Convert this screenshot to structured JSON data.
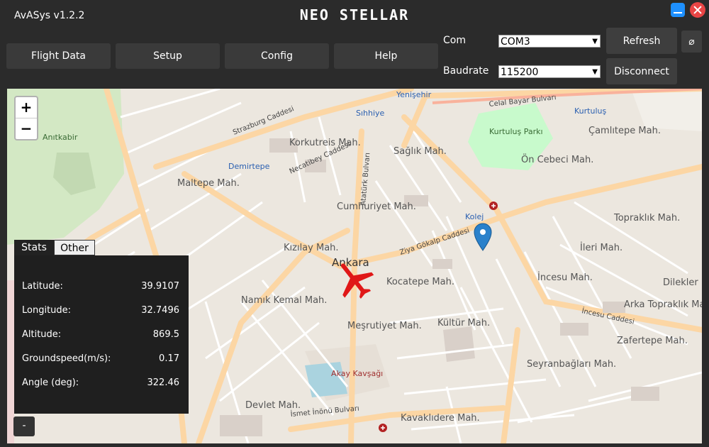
{
  "window": {
    "app_title": "AvASys v1.2.2",
    "brand": "NEO STELLAR"
  },
  "nav": {
    "flight_data": "Flight Data",
    "setup": "Setup",
    "config": "Config",
    "help": "Help"
  },
  "connection": {
    "com_label": "Com",
    "com_value": "COM3",
    "baud_label": "Baudrate",
    "baud_value": "115200",
    "refresh": "Refresh",
    "disconnect": "Disconnect",
    "extra_symbol": "⌀"
  },
  "map": {
    "zoom_in": "+",
    "zoom_out": "−",
    "labels": {
      "ankara": "Ankara",
      "kizilay": "Kızılay Mah.",
      "cumhuriyet": "Cumhuriyet Mah.",
      "kocatepe": "Kocatepe Mah.",
      "kultur": "Kültür Mah.",
      "mesrutiyet": "Meşrutiyet Mah.",
      "namik_kemal": "Namık Kemal Mah.",
      "maltepe": "Maltepe Mah.",
      "korkutreis": "Korkutreis Mah.",
      "saglik": "Sağlık Mah.",
      "on_cebeci": "Ön Cebeci Mah.",
      "ileri": "İleri Mah.",
      "incesu": "İncesu Mah.",
      "kurtulus_parki": "Kurtuluş Parkı",
      "camlitepe": "Çamlıtepe Mah.",
      "topraklik": "Topraklık Mah.",
      "dilekler": "Dilekler",
      "arka_topraklik": "Arka Topraklık Mah.",
      "zafertepe": "Zafertepe Mah.",
      "seyranbaglari": "Seyranbağları Mah.",
      "devlet": "Devlet Mah.",
      "kavaklidere": "Kavaklıdere Mah.",
      "anitkabir": "Anıtkabir",
      "ziya_gokalp": "Ziya Gökalp Caddesi",
      "ataturk_bulvari": "Atatürk Bulvarı",
      "celal_bayar": "Celal Bayar Bulvarı",
      "strazburg": "Strazburg Caddesi",
      "necatibey": "Necatibey Caddesi",
      "incesu_cad": "İncesu Caddesi",
      "ismet_inonu": "İsmet İnönü Bulvarı",
      "kurtulus": "Kurtuluş",
      "yenisehir": "Yenişehir",
      "sihhiye": "Sıhhiye",
      "demirtepe": "Demirtepe",
      "kolej": "Kolej",
      "akay": "Akay Kavşağı"
    }
  },
  "stats": {
    "tab_stats": "Stats",
    "tab_other": "Other",
    "rows": [
      {
        "label": "Latitude:",
        "value": "39.9107"
      },
      {
        "label": "Longitude:",
        "value": "32.7496"
      },
      {
        "label": "Altitude:",
        "value": "869.5"
      },
      {
        "label": "Groundspeed(m/s):",
        "value": "0.17"
      },
      {
        "label": "Angle (deg):",
        "value": "322.46"
      }
    ],
    "collapse": "-"
  },
  "colors": {
    "background": "#2b2b2b",
    "aircraft": "#e01818",
    "marker": "#2a81cb",
    "major_road": "#fcd6a4",
    "park": "#c8facc"
  }
}
